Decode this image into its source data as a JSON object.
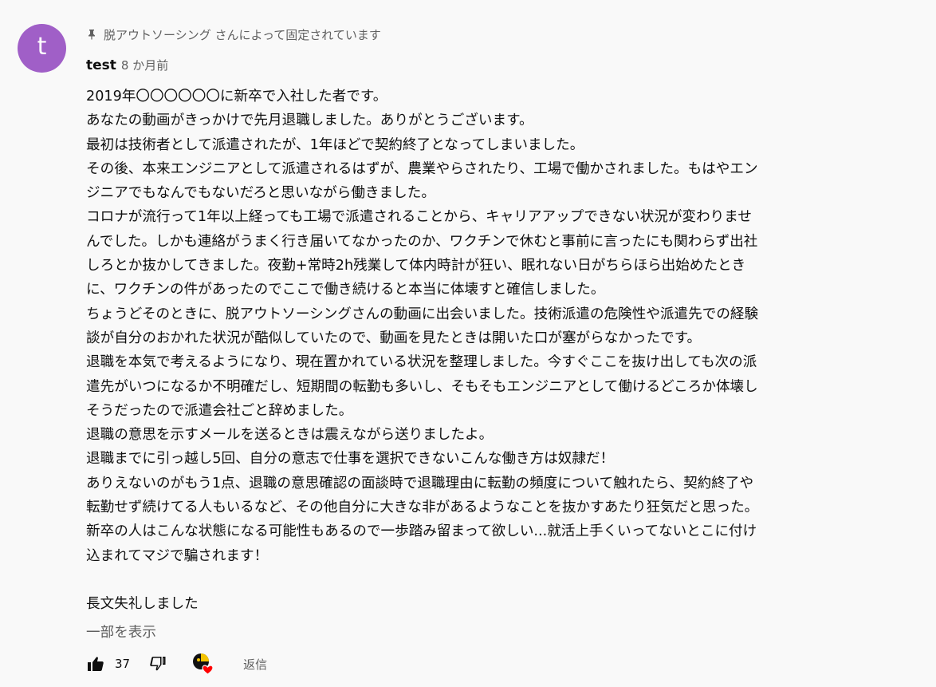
{
  "comment": {
    "avatar_letter": "t",
    "avatar_color": "#a05fc7",
    "pinned_text": "脱アウトソーシング さんによって固定されています",
    "author": "test",
    "date": "8 か月前",
    "lines": [
      "2019年〇〇〇〇〇〇に新卒で入社した者です。",
      "あなたの動画がきっかけで先月退職しました。ありがとうございます。",
      "最初は技術者として派遣されたが、1年ほどで契約終了となってしまいました。",
      "その後、本来エンジニアとして派遣されるはずが、農業やらされたり、工場で働かされました。もはやエン",
      "ジニアでもなんでもないだろと思いながら働きました。",
      "コロナが流行って1年以上経っても工場で派遣されることから、キャリアアップできない状況が変わりませ",
      "んでした。しかも連絡がうまく行き届いてなかったのか、ワクチンで休むと事前に言ったにも関わらず出社",
      "しろとか抜かしてきました。夜勤+常時2h残業して体内時計が狂い、眠れない日がちらほら出始めたとき",
      "に、ワクチンの件があったのでここで働き続けると本当に体壊すと確信しました。",
      "ちょうどそのときに、脱アウトソーシングさんの動画に出会いました。技術派遣の危険性や派遣先での経験",
      "談が自分のおかれた状況が酷似していたので、動画を見たときは開いた口が塞がらなかったです。",
      "退職を本気で考えるようになり、現在置かれている状況を整理しました。今すぐここを抜け出しても次の派",
      "遣先がいつになるか不明確だし、短期間の転勤も多いし、そもそもエンジニアとして働けるどころか体壊し",
      "そうだったので派遣会社ごと辞めました。",
      "退職の意思を示すメールを送るときは震えながら送りましたよ。",
      "退職までに引っ越し5回、自分の意志で仕事を選択できないこんな働き方は奴隷だ！",
      "ありえないのがもう1点、退職の意思確認の面談時で退職理由に転勤の頻度について触れたら、契約終了や",
      "転勤せず続けてる人もいるなど、その他自分に大きな非があるようなことを抜かすあたり狂気だと思った。",
      "新卒の人はこんな状態になる可能性もあるので一歩踏み留まって欲しい...就活上手くいってないとこに付け",
      "込まれてマジで騙されます！",
      "",
      "長文失礼しました"
    ],
    "show_more": "一部を表示",
    "like_count": "37",
    "reply_label": "返信"
  },
  "icons": {
    "pin": "pin-icon",
    "like": "thumbs-up-icon",
    "dislike": "thumbs-down-icon",
    "creator_heart": "creator-heart-icon",
    "heart_color": "#ff0000"
  }
}
